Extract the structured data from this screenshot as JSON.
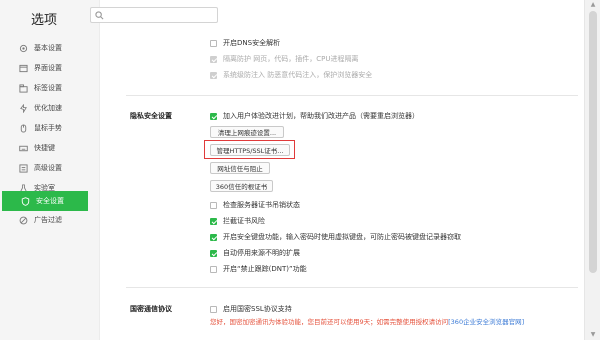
{
  "app": {
    "title": "选项"
  },
  "search": {
    "placeholder": ""
  },
  "sidebar": {
    "items": [
      {
        "label": "基本设置",
        "icon": "gear-icon"
      },
      {
        "label": "界面设置",
        "icon": "window-icon"
      },
      {
        "label": "标签设置",
        "icon": "tab-icon"
      },
      {
        "label": "优化加速",
        "icon": "lightning-icon"
      },
      {
        "label": "鼠标手势",
        "icon": "mouse-icon"
      },
      {
        "label": "快捷键",
        "icon": "keyboard-icon"
      },
      {
        "label": "高级设置",
        "icon": "advanced-icon"
      },
      {
        "label": "实验室",
        "icon": "flask-icon"
      },
      {
        "label": "安全设置",
        "icon": "shield-icon",
        "active": true
      },
      {
        "label": "广告过滤",
        "icon": "block-icon"
      }
    ]
  },
  "top_options": [
    {
      "label": "开启DNS安全解析",
      "checked": false,
      "disabled": false
    },
    {
      "label": "隔离防护  网页，代码，插件，CPU进程隔离",
      "checked": true,
      "disabled": true
    },
    {
      "label": "系统级防注入  防恶意代码注入，保护浏览器安全",
      "checked": true,
      "disabled": true
    }
  ],
  "privacy": {
    "title": "隐私安全设置",
    "join_plan": {
      "label": "加入用户体验改进计划，帮助我们改进产品",
      "note": "（需要重启浏览器）",
      "checked": true
    },
    "buttons": {
      "clear_history": "清理上网痕迹设置...",
      "manage_certs": "管理HTTPS/SSL证书...",
      "trust_block": "网址信任与阻止",
      "root_certs": "360信任的根证书"
    },
    "options": [
      {
        "label": "检查服务器证书吊销状态",
        "checked": false
      },
      {
        "label": "拦截证书风险",
        "checked": true
      },
      {
        "label": "开启安全键盘功能，输入密码时使用虚拟键盘，可防止密码被键盘记录器窃取",
        "checked": true
      },
      {
        "label": "自动停用来源不明的扩展",
        "checked": true
      },
      {
        "label": "开启“禁止跟踪(DNT)”功能",
        "checked": false
      }
    ]
  },
  "national_crypto": {
    "title": "国密通信协议",
    "option": {
      "label": "启用国密SSL协议支持",
      "checked": false
    },
    "notice": "您好，国密加密通讯为体验功能，您目前还可以使用9天；如需完整使用授权请访问",
    "link": "[360企业安全浏览器官网]"
  },
  "colors": {
    "accent": "#2cb94a",
    "highlight": "#e03a3a",
    "notice": "#e5533d",
    "link": "#3c7bd6"
  }
}
